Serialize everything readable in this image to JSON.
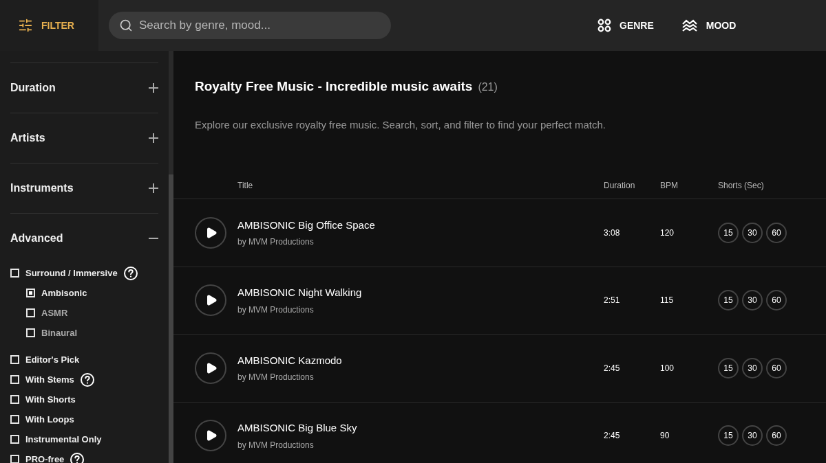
{
  "header": {
    "filter_label": "FILTER",
    "search": {
      "placeholder": "Search by genre, mood..."
    },
    "nav": [
      {
        "label": "GENRE",
        "kind": "grid"
      },
      {
        "label": "MOOD",
        "kind": "waves"
      }
    ]
  },
  "sidebar": {
    "sections": [
      {
        "label": "Duration",
        "expanded": false
      },
      {
        "label": "Artists",
        "expanded": false
      },
      {
        "label": "Instruments",
        "expanded": false
      },
      {
        "label": "Advanced",
        "expanded": true
      }
    ],
    "filters": [
      {
        "label": "Surround / Immersive",
        "checked": false,
        "help": true,
        "children": [
          {
            "label": "Ambisonic",
            "checked": true
          },
          {
            "label": "ASMR",
            "checked": false
          },
          {
            "label": "Binaural",
            "checked": false
          }
        ]
      },
      {
        "label": "Editor's Pick",
        "checked": false,
        "help": false
      },
      {
        "label": "With Stems",
        "checked": false,
        "help": true
      },
      {
        "label": "With Shorts",
        "checked": false,
        "help": false
      },
      {
        "label": "With Loops",
        "checked": false,
        "help": false
      },
      {
        "label": "Instrumental Only",
        "checked": false,
        "help": false
      },
      {
        "label": "PRO-free",
        "checked": false,
        "help": true
      }
    ]
  },
  "main": {
    "title": "Royalty Free Music - Incredible music awaits",
    "count": "(21)",
    "description": "Explore our exclusive royalty free music. Search, sort, and filter to find your perfect match.",
    "table": {
      "columns": [
        "Title",
        "Duration",
        "BPM",
        "Shorts (Sec)"
      ],
      "rows": [
        {
          "title": "AMBISONIC Big Office Space",
          "artist": "by MVM Productions",
          "duration": "3:08",
          "bpm": "120",
          "shorts": [
            "15",
            "30",
            "60"
          ]
        },
        {
          "title": "AMBISONIC Night Walking",
          "artist": "by MVM Productions",
          "duration": "2:51",
          "bpm": "115",
          "shorts": [
            "15",
            "30",
            "60"
          ]
        },
        {
          "title": "AMBISONIC Kazmodo",
          "artist": "by MVM Productions",
          "duration": "2:45",
          "bpm": "100",
          "shorts": [
            "15",
            "30",
            "60"
          ]
        },
        {
          "title": "AMBISONIC Big Blue Sky",
          "artist": "by MVM Productions",
          "duration": "2:45",
          "bpm": "90",
          "shorts": [
            "15",
            "30",
            "60"
          ]
        }
      ]
    }
  }
}
